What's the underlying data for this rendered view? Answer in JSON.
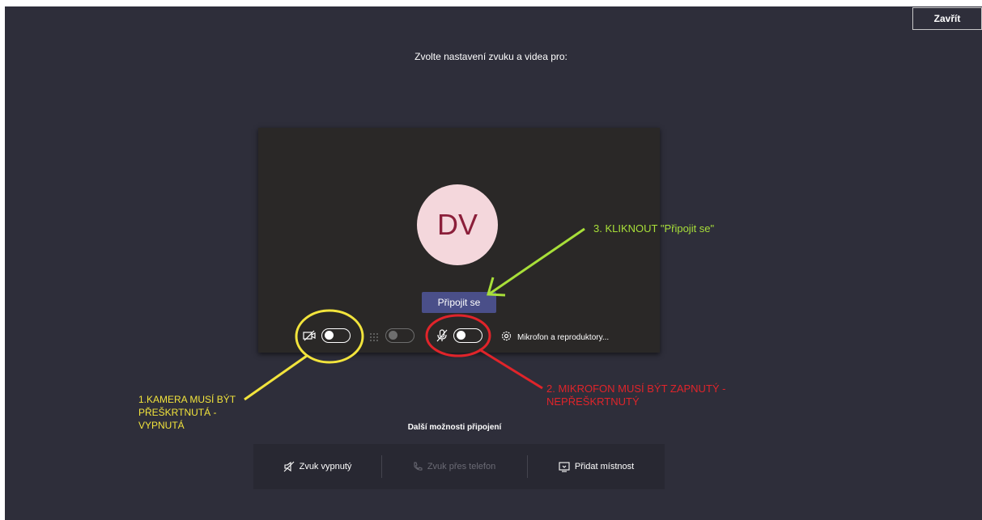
{
  "window": {
    "close_label": "Zavřít"
  },
  "setup": {
    "heading": "Zvolte nastavení zvuku a videa pro:",
    "avatar_initials": "DV",
    "join_label": "Připojit se",
    "device_label": "Mikrofon a reproduktory...",
    "camera_toggle": "off",
    "blur_toggle": "disabled",
    "mic_toggle": "off"
  },
  "more_options": {
    "title": "Další možnosti připojení",
    "items": [
      {
        "label": "Zvuk vypnutý",
        "icon": "speaker-off-icon"
      },
      {
        "label": "Zvuk přes telefon",
        "icon": "phone-icon"
      },
      {
        "label": "Přidat místnost",
        "icon": "room-icon"
      }
    ]
  },
  "annotations": {
    "camera": [
      "1.KAMERA MUSÍ BÝT",
      "PŘEŠKRTNUTÁ -",
      "VYPNUTÁ"
    ],
    "mic": [
      "2. MIKROFON MUSÍ BÝT ZAPNUTÝ -",
      "NEPŘEŠKRTNUTÝ"
    ],
    "join": "3. KLIKNOUT \"Připojit se\""
  },
  "colors": {
    "background": "#2e2e3a",
    "accent": "#4a4f89",
    "annotation_yellow": "#f2e43c",
    "annotation_red": "#e0242a",
    "annotation_green": "#a8df39"
  }
}
